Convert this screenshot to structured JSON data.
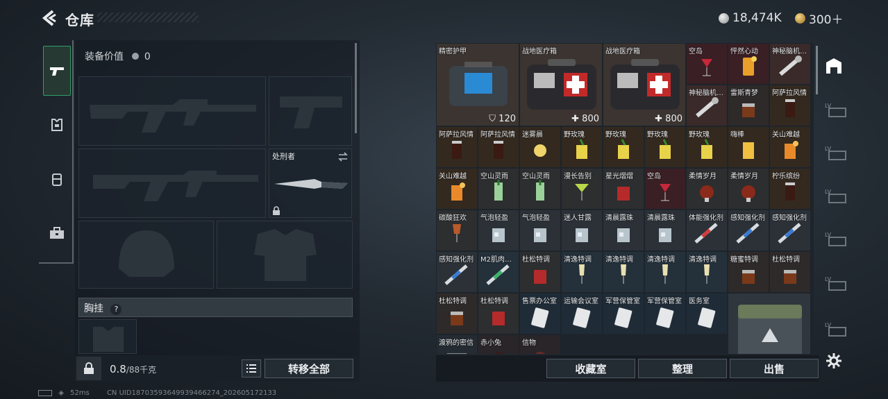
{
  "header": {
    "title": "仓库",
    "currency1": "18,474K",
    "currency2": "300＋"
  },
  "left": {
    "equip_value_label": "装备价值",
    "equip_value": "0",
    "melee_name": "处刑者",
    "chest_label": "胸挂",
    "chest_help": "?",
    "capacity_used": "0.8",
    "capacity_total": "/88千克",
    "transfer_all": "转移全部"
  },
  "grid": {
    "items": [
      {
        "name": "精密护甲",
        "value": "120",
        "icon": "armor-box-icon",
        "slot": "big-armor"
      },
      {
        "name": "战地医疗箱",
        "value": "800",
        "icon": "medkit-icon",
        "slot": "big-med1"
      },
      {
        "name": "战地医疗箱",
        "value": "800",
        "icon": "medkit-icon",
        "slot": "big-med2"
      },
      {
        "name": "空岛",
        "icon": "cocktail-red-icon"
      },
      {
        "name": "怦然心动",
        "icon": "cocktail-orange-icon"
      },
      {
        "name": "神秘脑机…",
        "icon": "chip-icon"
      },
      {
        "name": "神秘脑机…",
        "icon": "chip-icon"
      },
      {
        "name": "雷斯青梦",
        "icon": "whiskey-icon"
      },
      {
        "name": "阿萨拉风情",
        "icon": "cola-glass-icon"
      },
      {
        "name": "阿萨拉风情",
        "icon": "cola-glass-icon"
      },
      {
        "name": "阿萨拉风情",
        "icon": "cola-glass-icon"
      },
      {
        "name": "迷雾晨",
        "icon": "lemon-drink-icon"
      },
      {
        "name": "野玫瑰",
        "icon": "yellow-cocktail-icon"
      },
      {
        "name": "野玫瑰",
        "icon": "yellow-cocktail-icon"
      },
      {
        "name": "野玫瑰",
        "icon": "yellow-cocktail-icon"
      },
      {
        "name": "野玫瑰",
        "icon": "yellow-cocktail-icon"
      },
      {
        "name": "嗨棒",
        "icon": "highball-icon"
      },
      {
        "name": "关山难越",
        "icon": "sunset-drink-icon"
      },
      {
        "name": "关山难越",
        "icon": "sunset-drink-icon"
      },
      {
        "name": "空山灵雨",
        "icon": "mojito-icon"
      },
      {
        "name": "空山灵雨",
        "icon": "mojito-icon"
      },
      {
        "name": "漫长告别",
        "icon": "martini-icon"
      },
      {
        "name": "星光熠熠",
        "icon": "red-tumbler-icon"
      },
      {
        "name": "空岛",
        "icon": "cocktail-red-icon"
      },
      {
        "name": "柔情岁月",
        "icon": "brandy-icon"
      },
      {
        "name": "柔情岁月",
        "icon": "brandy-icon"
      },
      {
        "name": "柠乐缤纷",
        "icon": "cola-glass-icon"
      },
      {
        "name": "碳酸狂欢",
        "icon": "wine-glass-icon"
      },
      {
        "name": "气泡轻盈",
        "icon": "ice-glass-icon"
      },
      {
        "name": "气泡轻盈",
        "icon": "ice-glass-icon"
      },
      {
        "name": "迷人甘露",
        "icon": "ice-glass-icon"
      },
      {
        "name": "清晨露珠",
        "icon": "ice-glass-icon"
      },
      {
        "name": "清晨露珠",
        "icon": "ice-glass-icon"
      },
      {
        "name": "体能强化剂",
        "icon": "syringe-red-icon"
      },
      {
        "name": "感知强化剂",
        "icon": "syringe-blue-icon"
      },
      {
        "name": "感知强化剂",
        "icon": "syringe-blue-icon"
      },
      {
        "name": "感知强化剂",
        "icon": "syringe-blue-icon"
      },
      {
        "name": "M2肌肉…",
        "icon": "syringe-green-icon"
      },
      {
        "name": "杜松特调",
        "icon": "red-tumbler-icon"
      },
      {
        "name": "清逸特调",
        "icon": "champagne-icon"
      },
      {
        "name": "清逸特调",
        "icon": "champagne-icon"
      },
      {
        "name": "清逸特调",
        "icon": "champagne-icon"
      },
      {
        "name": "清逸特调",
        "icon": "champagne-icon"
      },
      {
        "name": "糖蜜特调",
        "icon": "whiskey-icon"
      },
      {
        "name": "杜松特调",
        "icon": "whiskey-icon"
      },
      {
        "name": "杜松特调",
        "icon": "whiskey-icon"
      },
      {
        "name": "杜松特调",
        "icon": "red-tumbler-icon"
      },
      {
        "name": "售票办公室",
        "icon": "keycard-icon"
      },
      {
        "name": "运输会议室",
        "icon": "keycard-icon"
      },
      {
        "name": "军营保管室",
        "icon": "keycard-icon"
      },
      {
        "name": "军营保管室",
        "icon": "keycard-icon"
      },
      {
        "name": "医务室",
        "icon": "keycard-icon"
      },
      {
        "name": "渡鸦的密信",
        "icon": "letter-icon"
      },
      {
        "name": "赤小兔",
        "icon": "rabbit-icon"
      },
      {
        "name": "信物",
        "icon": "token-icon"
      }
    ]
  },
  "buttons": {
    "collection": "收藏室",
    "sort": "整理",
    "sell": "出售"
  },
  "status": {
    "ping": "52ms",
    "uid": "CN UID18703593649939466274_202605172133"
  },
  "colors": {
    "accent_green": "#2ea06a",
    "panel": "#1d242b"
  }
}
